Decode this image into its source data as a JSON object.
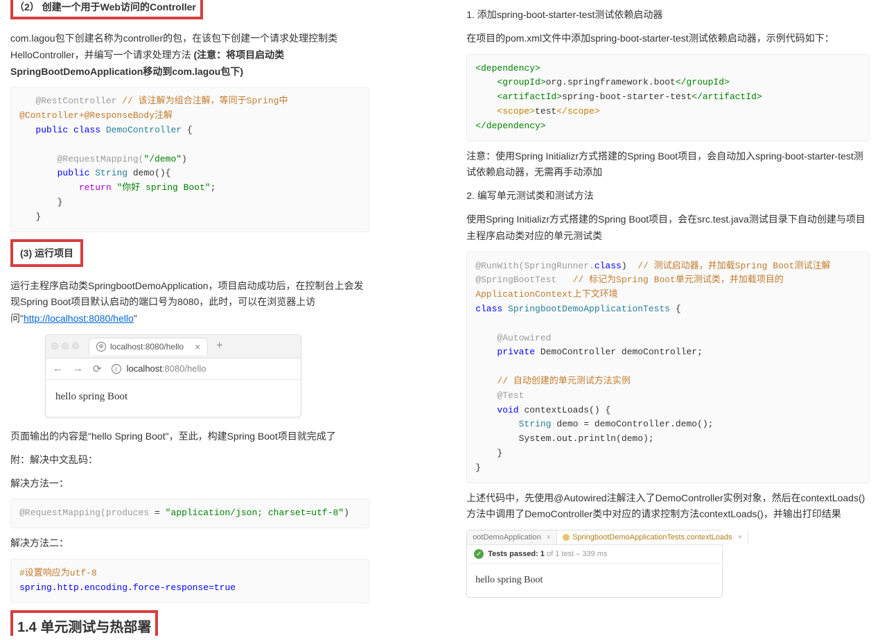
{
  "left": {
    "h2_box": "（2） 创建一个用于Web访问的Controller",
    "p1_a": "com.lagou包下创建名称为controller的包，在该包下创建一个请求处理控制类HelloController，并编写一个请求处理方法 ",
    "p1_b": "(注意：将项目启动类SpringBootDemoApplication移动到com.lagou包下)",
    "code1": {
      "l1a": "@RestController",
      "l1b": "// 该注解为组合注解，等同于Spring中@Controller+@ResponseBody注解",
      "l2a": "public",
      "l2b": "class",
      "l2c": "DemoController",
      "l2d": "{",
      "l3a": "@RequestMapping(",
      "l3b": "\"/demo\"",
      "l3c": ")",
      "l4a": "public",
      "l4b": "String",
      "l4c": "demo(){",
      "l5a": "return",
      "l5b": "\"你好 spring Boot\"",
      "l5c": ";",
      "l6": "}",
      "l7": "}"
    },
    "h3_box": "(3) 运行项目",
    "p2_a": "运行主程序启动类SpringbootDemoApplication，项目启动成功后，在控制台上会发现Spring Boot项目默认启动的端口号为8080，此时，可以在浏览器上访问\"",
    "p2_link": "http://localhost:8080/hello",
    "p2_b": "\"",
    "browser": {
      "tab": "localhost:8080/hello",
      "host": "localhost",
      "port_path": ":8080/hello",
      "content": "hello spring Boot"
    },
    "p3": "页面输出的内容是\"hello Spring Boot\"，至此，构建Spring Boot项目就完成了",
    "p4": "附：解决中文乱码：",
    "p5": "解决方法一：",
    "code2": {
      "a": "@RequestMapping(produces ",
      "b": "=",
      "c": " \"application/json; charset=utf-8\"",
      "d": ")"
    },
    "p6": "解决方法二：",
    "code3": {
      "l1": "#设置响应为utf-8",
      "l2a": "spring.http.encoding.force-response=",
      "l2b": "true"
    },
    "h1_box": "1.4 单元测试与热部署"
  },
  "right": {
    "p1": "1.  添加spring-boot-starter-test测试依赖启动器",
    "p2": "在项目的pom.xml文件中添加spring-boot-starter-test测试依赖启动器，示例代码如下：",
    "code1": {
      "dep_o": "<dependency>",
      "gid_o": "<groupId>",
      "gid_v": "org.springframework.boot",
      "gid_c": "</groupId>",
      "aid_o": "<artifactId>",
      "aid_v": "spring-boot-starter-test",
      "aid_c": "</artifactId>",
      "sc_o": "<scope>",
      "sc_v": "test",
      "sc_c": "</scope>",
      "dep_c": "</dependency>"
    },
    "p3": "注意：使用Spring Initializr方式搭建的Spring Boot项目，会自动加入spring-boot-starter-test测试依赖启动器，无需再手动添加",
    "p4": "2.  编写单元测试类和测试方法",
    "p5": "使用Spring Initializr方式搭建的Spring Boot项目，会在src.test.java测试目录下自动创建与项目主程序启动类对应的单元测试类",
    "code2": {
      "l1a": "@RunWith(SpringRunner.",
      "l1b": "class",
      "l1c": ")",
      "l1d": "// 测试启动器，并加载Spring Boot测试注解",
      "l2a": "@SpringBootTest",
      "l2b": "// 标记为Spring Boot单元测试类，并加载项目的ApplicationContext上下文环境",
      "l3a": "class",
      "l3b": "SpringbootDemoApplicationTests",
      "l3c": "{",
      "l4": "@Autowired",
      "l5a": "private",
      "l5b": "DemoController demoController;",
      "l6": "// 自动创建的单元测试方法实例",
      "l7": "@Test",
      "l8a": "void",
      "l8b": "contextLoads() {",
      "l9a": "String",
      "l9b": "demo = demoController.demo();",
      "l10": "System.out.println(demo);",
      "l11": "}",
      "l12": "}"
    },
    "p6": "上述代码中，先使用@Autowired注解注入了DemoController实例对象，然后在contextLoads()方法中调用了DemoController类中对应的请求控制方法contextLoads()，并输出打印结果",
    "runner": {
      "tab1": "ootDemoApplication",
      "tab2": "SpringbootDemoApplicationTests.contextLoads",
      "status_a": "Tests passed: 1",
      "status_b": " of 1 test – 339 ms",
      "out": "hello spring Boot"
    }
  }
}
